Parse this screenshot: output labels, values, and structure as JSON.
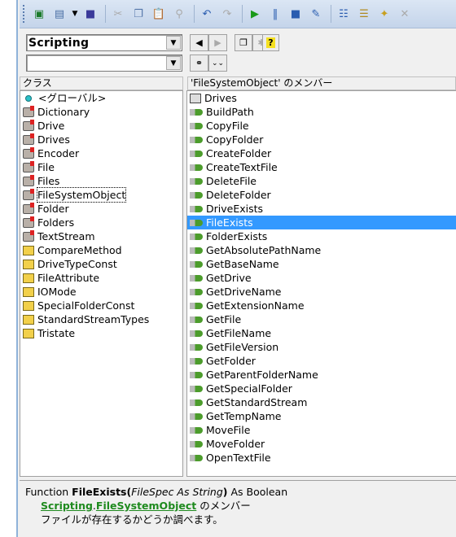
{
  "toolbar": {
    "icons": [
      "excel-icon",
      "userform-icon",
      "dropdown-icon",
      "save-icon",
      "cut-icon",
      "copy-icon",
      "paste-icon",
      "find-icon",
      "undo-icon",
      "redo-icon",
      "run-icon",
      "break-icon",
      "reset-icon",
      "design-mode-icon",
      "project-explorer-icon",
      "properties-icon",
      "object-browser-icon",
      "toolbox-icon"
    ]
  },
  "library_combo": {
    "value": "Scripting"
  },
  "search_combo": {
    "value": ""
  },
  "classes_header": "クラス",
  "members_header": "'FileSystemObject' のメンバー",
  "classes": [
    {
      "label": "<グローバル>",
      "icon": "globe"
    },
    {
      "label": "Dictionary",
      "icon": "class"
    },
    {
      "label": "Drive",
      "icon": "class"
    },
    {
      "label": "Drives",
      "icon": "class"
    },
    {
      "label": "Encoder",
      "icon": "class"
    },
    {
      "label": "File",
      "icon": "class"
    },
    {
      "label": "Files",
      "icon": "class"
    },
    {
      "label": "FileSystemObject",
      "icon": "class",
      "focused": true
    },
    {
      "label": "Folder",
      "icon": "class"
    },
    {
      "label": "Folders",
      "icon": "class"
    },
    {
      "label": "TextStream",
      "icon": "class"
    },
    {
      "label": "CompareMethod",
      "icon": "enum"
    },
    {
      "label": "DriveTypeConst",
      "icon": "enum"
    },
    {
      "label": "FileAttribute",
      "icon": "enum"
    },
    {
      "label": "IOMode",
      "icon": "enum"
    },
    {
      "label": "SpecialFolderConst",
      "icon": "enum"
    },
    {
      "label": "StandardStreamTypes",
      "icon": "enum"
    },
    {
      "label": "Tristate",
      "icon": "enum"
    }
  ],
  "members": [
    {
      "label": "Drives",
      "icon": "property"
    },
    {
      "label": "BuildPath",
      "icon": "method"
    },
    {
      "label": "CopyFile",
      "icon": "method"
    },
    {
      "label": "CopyFolder",
      "icon": "method"
    },
    {
      "label": "CreateFolder",
      "icon": "method"
    },
    {
      "label": "CreateTextFile",
      "icon": "method"
    },
    {
      "label": "DeleteFile",
      "icon": "method"
    },
    {
      "label": "DeleteFolder",
      "icon": "method"
    },
    {
      "label": "DriveExists",
      "icon": "method"
    },
    {
      "label": "FileExists",
      "icon": "method",
      "selected": true
    },
    {
      "label": "FolderExists",
      "icon": "method"
    },
    {
      "label": "GetAbsolutePathName",
      "icon": "method"
    },
    {
      "label": "GetBaseName",
      "icon": "method"
    },
    {
      "label": "GetDrive",
      "icon": "method"
    },
    {
      "label": "GetDriveName",
      "icon": "method"
    },
    {
      "label": "GetExtensionName",
      "icon": "method"
    },
    {
      "label": "GetFile",
      "icon": "method"
    },
    {
      "label": "GetFileName",
      "icon": "method"
    },
    {
      "label": "GetFileVersion",
      "icon": "method"
    },
    {
      "label": "GetFolder",
      "icon": "method"
    },
    {
      "label": "GetParentFolderName",
      "icon": "method"
    },
    {
      "label": "GetSpecialFolder",
      "icon": "method"
    },
    {
      "label": "GetStandardStream",
      "icon": "method"
    },
    {
      "label": "GetTempName",
      "icon": "method"
    },
    {
      "label": "MoveFile",
      "icon": "method"
    },
    {
      "label": "MoveFolder",
      "icon": "method"
    },
    {
      "label": "OpenTextFile",
      "icon": "method"
    }
  ],
  "details": {
    "kind": "Function",
    "name": "FileExists",
    "open": "(",
    "params": "FileSpec As String",
    "close": ")",
    "returns": " As Boolean",
    "library_link": "Scripting",
    "dot": ".",
    "class_link": "FileSystemObject",
    "member_of": " のメンバー",
    "description": "ファイルが存在するかどうか調べます。"
  },
  "colors": {
    "selection": "#3399ff",
    "link": "#1e8a1e"
  }
}
